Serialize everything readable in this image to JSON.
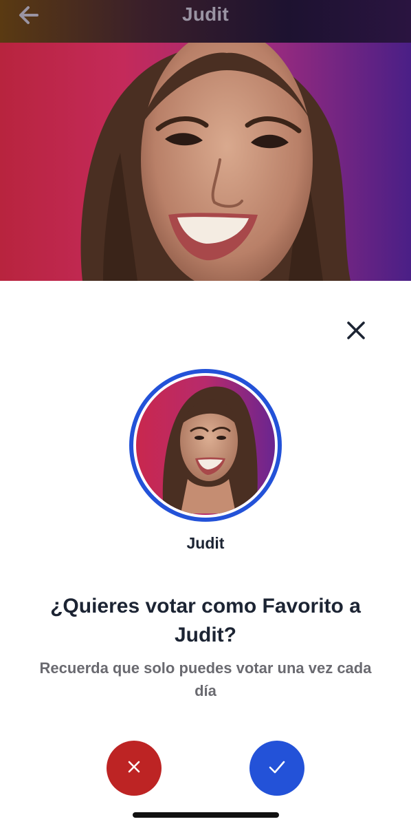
{
  "header": {
    "title": "Judit",
    "back_icon": "arrow-left-icon"
  },
  "hero": {
    "image": "contestant-portrait"
  },
  "sheet": {
    "close_icon": "close-icon",
    "avatar_name": "Judit",
    "question": "¿Quieres votar como Favorito a Judit?",
    "note": "Recuerda que solo puedes votar una vez cada día",
    "cancel_icon": "x-icon",
    "confirm_icon": "check-icon"
  },
  "colors": {
    "accent_blue": "#2352d8",
    "cancel_red": "#bd2424",
    "text_dark": "#1c2433",
    "text_muted": "#6a6a70"
  }
}
